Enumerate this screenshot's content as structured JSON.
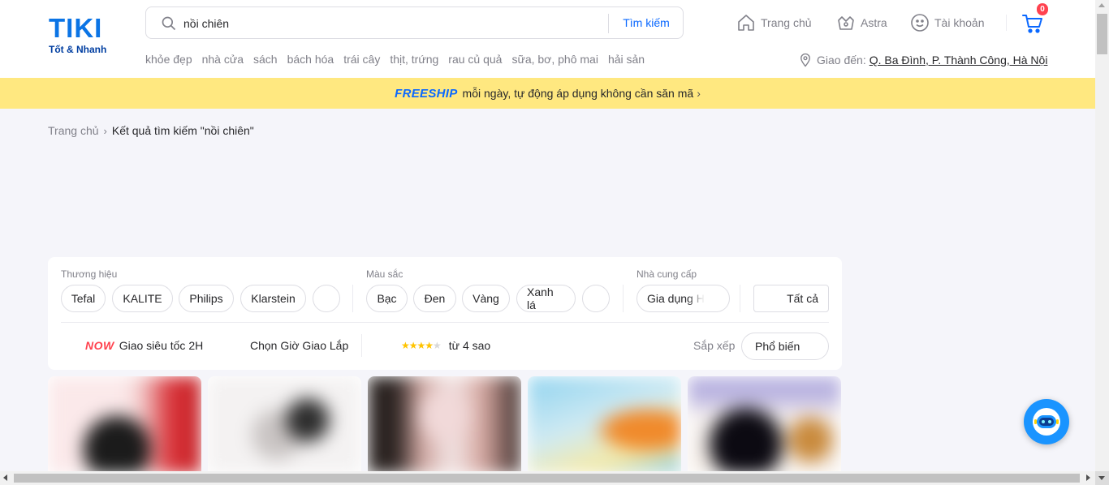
{
  "brand": {
    "name": "TIKI",
    "tagline": "Tốt & Nhanh",
    "primary_color": "#0b74e5"
  },
  "search": {
    "value": "nồi chiên",
    "button_label": "Tìm kiếm"
  },
  "quick_links": [
    "khỏe đẹp",
    "nhà cửa",
    "sách",
    "bách hóa",
    "trái cây",
    "thịt, trứng",
    "rau củ quả",
    "sữa, bơ, phô mai",
    "hải sản"
  ],
  "nav": {
    "home": "Trang chủ",
    "astra": "Astra",
    "account": "Tài khoản",
    "cart_count": "0"
  },
  "delivery": {
    "label": "Giao đến:",
    "address": "Q. Ba Đình, P. Thành Công, Hà Nội"
  },
  "promo": {
    "highlight": "FREESHIP",
    "text": "mỗi ngày, tự động áp dụng không cần săn mã"
  },
  "breadcrumb": {
    "home": "Trang chủ",
    "current": "Kết quả tìm kiếm \"nồi chiên\""
  },
  "filters": {
    "brand": {
      "title": "Thương hiệu",
      "options": [
        "Tefal",
        "KALITE",
        "Philips",
        "Klarstein"
      ]
    },
    "color": {
      "title": "Màu sắc",
      "options": [
        "Bạc",
        "Đen",
        "Vàng",
        "Xanh lá"
      ]
    },
    "supplier": {
      "title": "Nhà cung cấp",
      "options": [
        "Gia dụng H"
      ]
    },
    "all_label": "Tất cả",
    "now_tag": "NOW",
    "fast_delivery": "Giao siêu tốc 2H",
    "schedule": "Chọn Giờ Giao Lắp",
    "rating": {
      "stars": 4,
      "label": "từ 4 sao"
    },
    "sort": {
      "label": "Sắp xếp",
      "value": "Phổ biến"
    }
  },
  "products": [
    {
      "id": "p1"
    },
    {
      "id": "p2"
    },
    {
      "id": "p3"
    },
    {
      "id": "p4"
    },
    {
      "id": "p5"
    }
  ]
}
